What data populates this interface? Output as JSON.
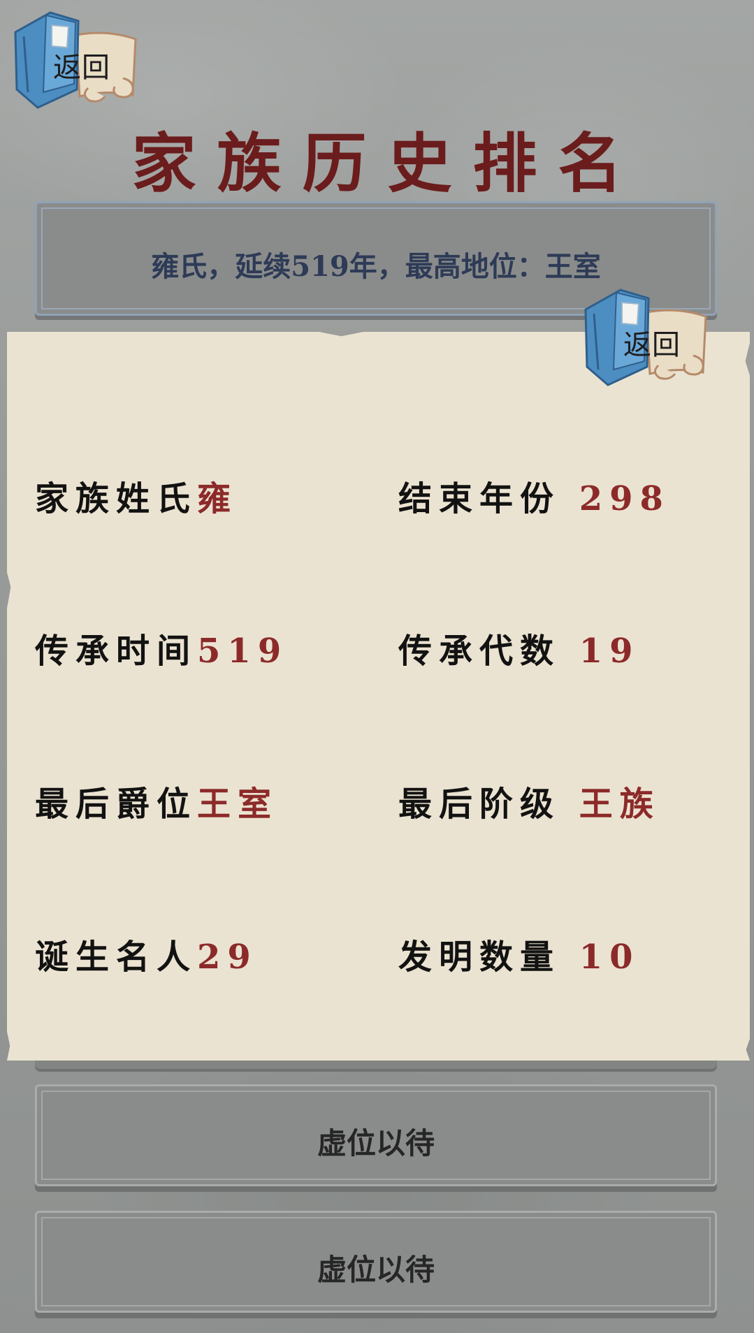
{
  "header": {
    "back_label": "返回",
    "title": "家族历史排名"
  },
  "summary": {
    "text": "雍氏，延续519年，最高地位：王室"
  },
  "panel": {
    "back_label": "返回",
    "stats": {
      "surname": {
        "label": "家族姓氏",
        "value": "雍"
      },
      "end_year": {
        "label": "结束年份 ",
        "value": "298"
      },
      "duration": {
        "label": "传承时间",
        "value": "519"
      },
      "generations": {
        "label": "传承代数 ",
        "value": "19"
      },
      "last_title": {
        "label": "最后爵位",
        "value": "王室"
      },
      "last_class": {
        "label": "最后阶级 ",
        "value": "王族"
      },
      "famous": {
        "label": "诞生名人",
        "value": "29"
      },
      "inventions": {
        "label": "发明数量 ",
        "value": "10"
      }
    }
  },
  "ranking_slots": [
    {
      "label": "虚位以待"
    },
    {
      "label": "虚位以待"
    }
  ],
  "colors": {
    "title": "#6b1c1c",
    "summary_text": "#2e3b57",
    "stat_value": "#8c2a2a",
    "parchment": "#ebe3d1",
    "background": "#8f9290"
  },
  "icons": {
    "back": "book-scroll-icon"
  }
}
